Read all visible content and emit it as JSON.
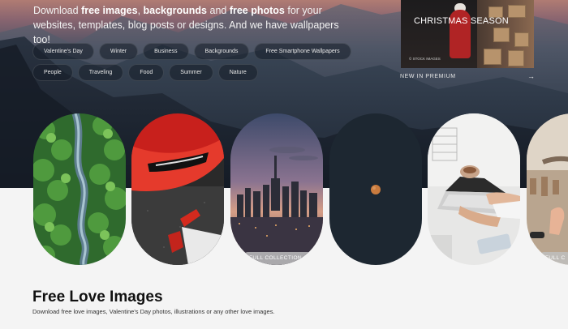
{
  "hero": {
    "intro_parts": [
      {
        "text": "Download ",
        "bold": false
      },
      {
        "text": "free images",
        "bold": true
      },
      {
        "text": ", ",
        "bold": false
      },
      {
        "text": "backgrounds",
        "bold": true
      },
      {
        "text": " and ",
        "bold": false
      },
      {
        "text": "free photos",
        "bold": true
      },
      {
        "text": " for your websites, templates, blog posts or designs. And we have wallpapers too!",
        "bold": false
      }
    ],
    "tags_row1": [
      "Valentine's Day",
      "Winter",
      "Business",
      "Backgrounds",
      "Free Smartphone Wallpapers"
    ],
    "tags_row2": [
      "People",
      "Traveling",
      "Food",
      "Summer",
      "Nature"
    ]
  },
  "premium": {
    "card_title": "CHRISTMAS SEASON",
    "card_badge": "© STOCK IMAGES",
    "caption": "NEW IN PREMIUM",
    "arrow": "→"
  },
  "collections": {
    "button_label": "FULL COLLECTION ↗",
    "button_label_short": "FULL C"
  },
  "section": {
    "title": "Free Love Images",
    "description": "Download free love images, Valentine's Day photos, illustrations or any other love images."
  },
  "colors": {
    "page_background": "#f4f4f4",
    "hero_dark": "#1f2a37",
    "hero_sky": "#b07c73"
  }
}
